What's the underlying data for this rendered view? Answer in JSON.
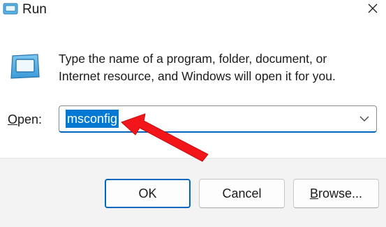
{
  "window": {
    "title": "Run",
    "title_icon": "run-app-icon",
    "close_icon": "close-icon"
  },
  "body": {
    "app_icon": "run-dialog-icon",
    "description_line1": "Type the name of a program, folder, document, or",
    "description_line2": "Internet resource, and Windows will open it for you."
  },
  "open_field": {
    "label_accel": "O",
    "label_rest": "pen:",
    "value": "msconfig",
    "dropdown_icon": "chevron-down-icon"
  },
  "annotation": {
    "type": "red-arrow",
    "color": "#f2161a"
  },
  "buttons": {
    "ok_label": "OK",
    "cancel_label": "Cancel",
    "browse_accel": "B",
    "browse_rest": "rowse..."
  },
  "colors": {
    "accent": "#0067c0",
    "selection": "#0078d4",
    "footer_bg": "#f3f3f3"
  }
}
